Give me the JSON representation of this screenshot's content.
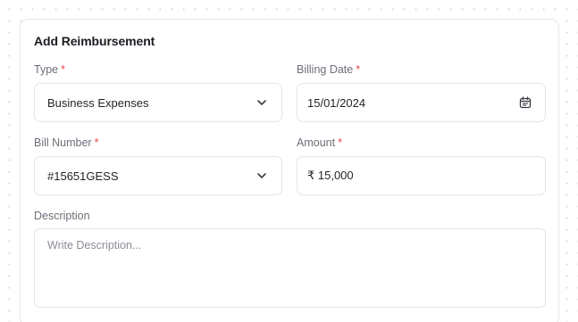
{
  "form": {
    "title": "Add Reimbursement",
    "type": {
      "label": "Type",
      "required_mark": "*",
      "value": "Business Expenses",
      "icon": "chevron-down-icon"
    },
    "billing_date": {
      "label": "Billing Date",
      "required_mark": "*",
      "value": "15/01/2024",
      "icon": "calendar-icon"
    },
    "bill_number": {
      "label": "Bill Number",
      "required_mark": "*",
      "value": "#15651GESS",
      "icon": "chevron-down-icon"
    },
    "amount": {
      "label": "Amount",
      "required_mark": "*",
      "value": "₹ 15,000"
    },
    "description": {
      "label": "Description",
      "placeholder": "Write Description..."
    }
  },
  "colors": {
    "required": "#e5484d",
    "label": "#6b6f78",
    "border": "#e3e5e9"
  }
}
